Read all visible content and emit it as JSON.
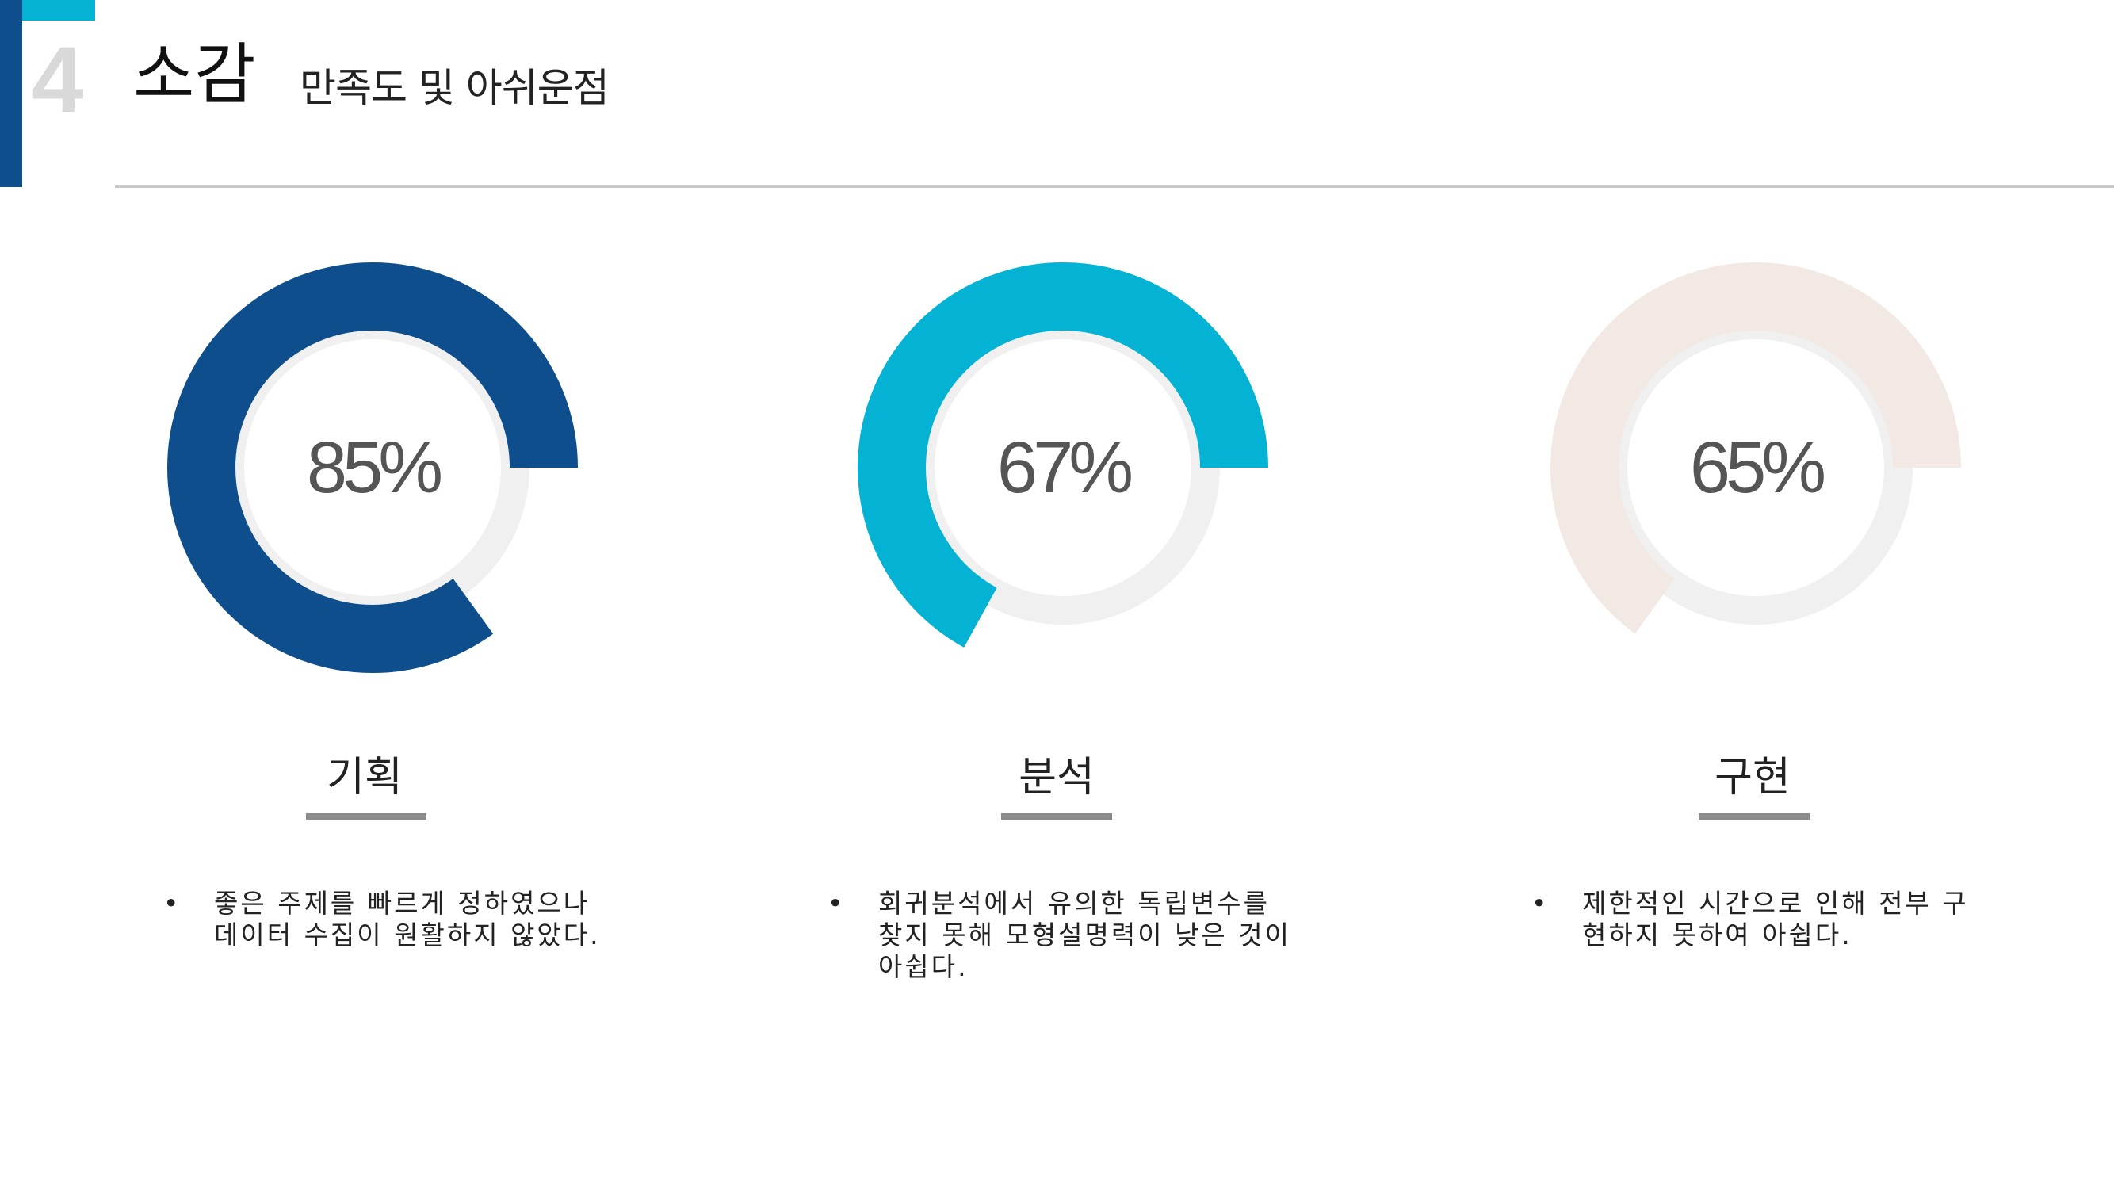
{
  "header": {
    "section_number": "4",
    "title": "소감",
    "subtitle": "만족도 및 아쉬운점"
  },
  "colors": {
    "navy": "#0f4e8c",
    "cyan": "#04b2d4",
    "beige": "#f2e9e4",
    "track": "#f0f0f0",
    "number_gray": "#d9d9d9"
  },
  "chart_data": [
    {
      "type": "pie",
      "category": "기획",
      "value": 85,
      "label": "85%",
      "color": "#0f4e8c"
    },
    {
      "type": "pie",
      "category": "분석",
      "value": 67,
      "label": "67%",
      "color": "#04b2d4"
    },
    {
      "type": "pie",
      "category": "구현",
      "value": 65,
      "label": "65%",
      "color": "#f2e9e4"
    }
  ],
  "notes": [
    {
      "bullet": "•",
      "lines": [
        "좋은 주제를 빠르게 정하였으나",
        "데이터 수집이 원활하지 않았다."
      ]
    },
    {
      "bullet": "•",
      "lines": [
        "회귀분석에서 유의한 독립변수를",
        "찾지 못해 모형설명력이 낮은 것이",
        "아쉽다."
      ]
    },
    {
      "bullet": "•",
      "lines": [
        "제한적인 시간으로 인해 전부 구",
        "현하지 못하여 아쉽다."
      ]
    }
  ]
}
